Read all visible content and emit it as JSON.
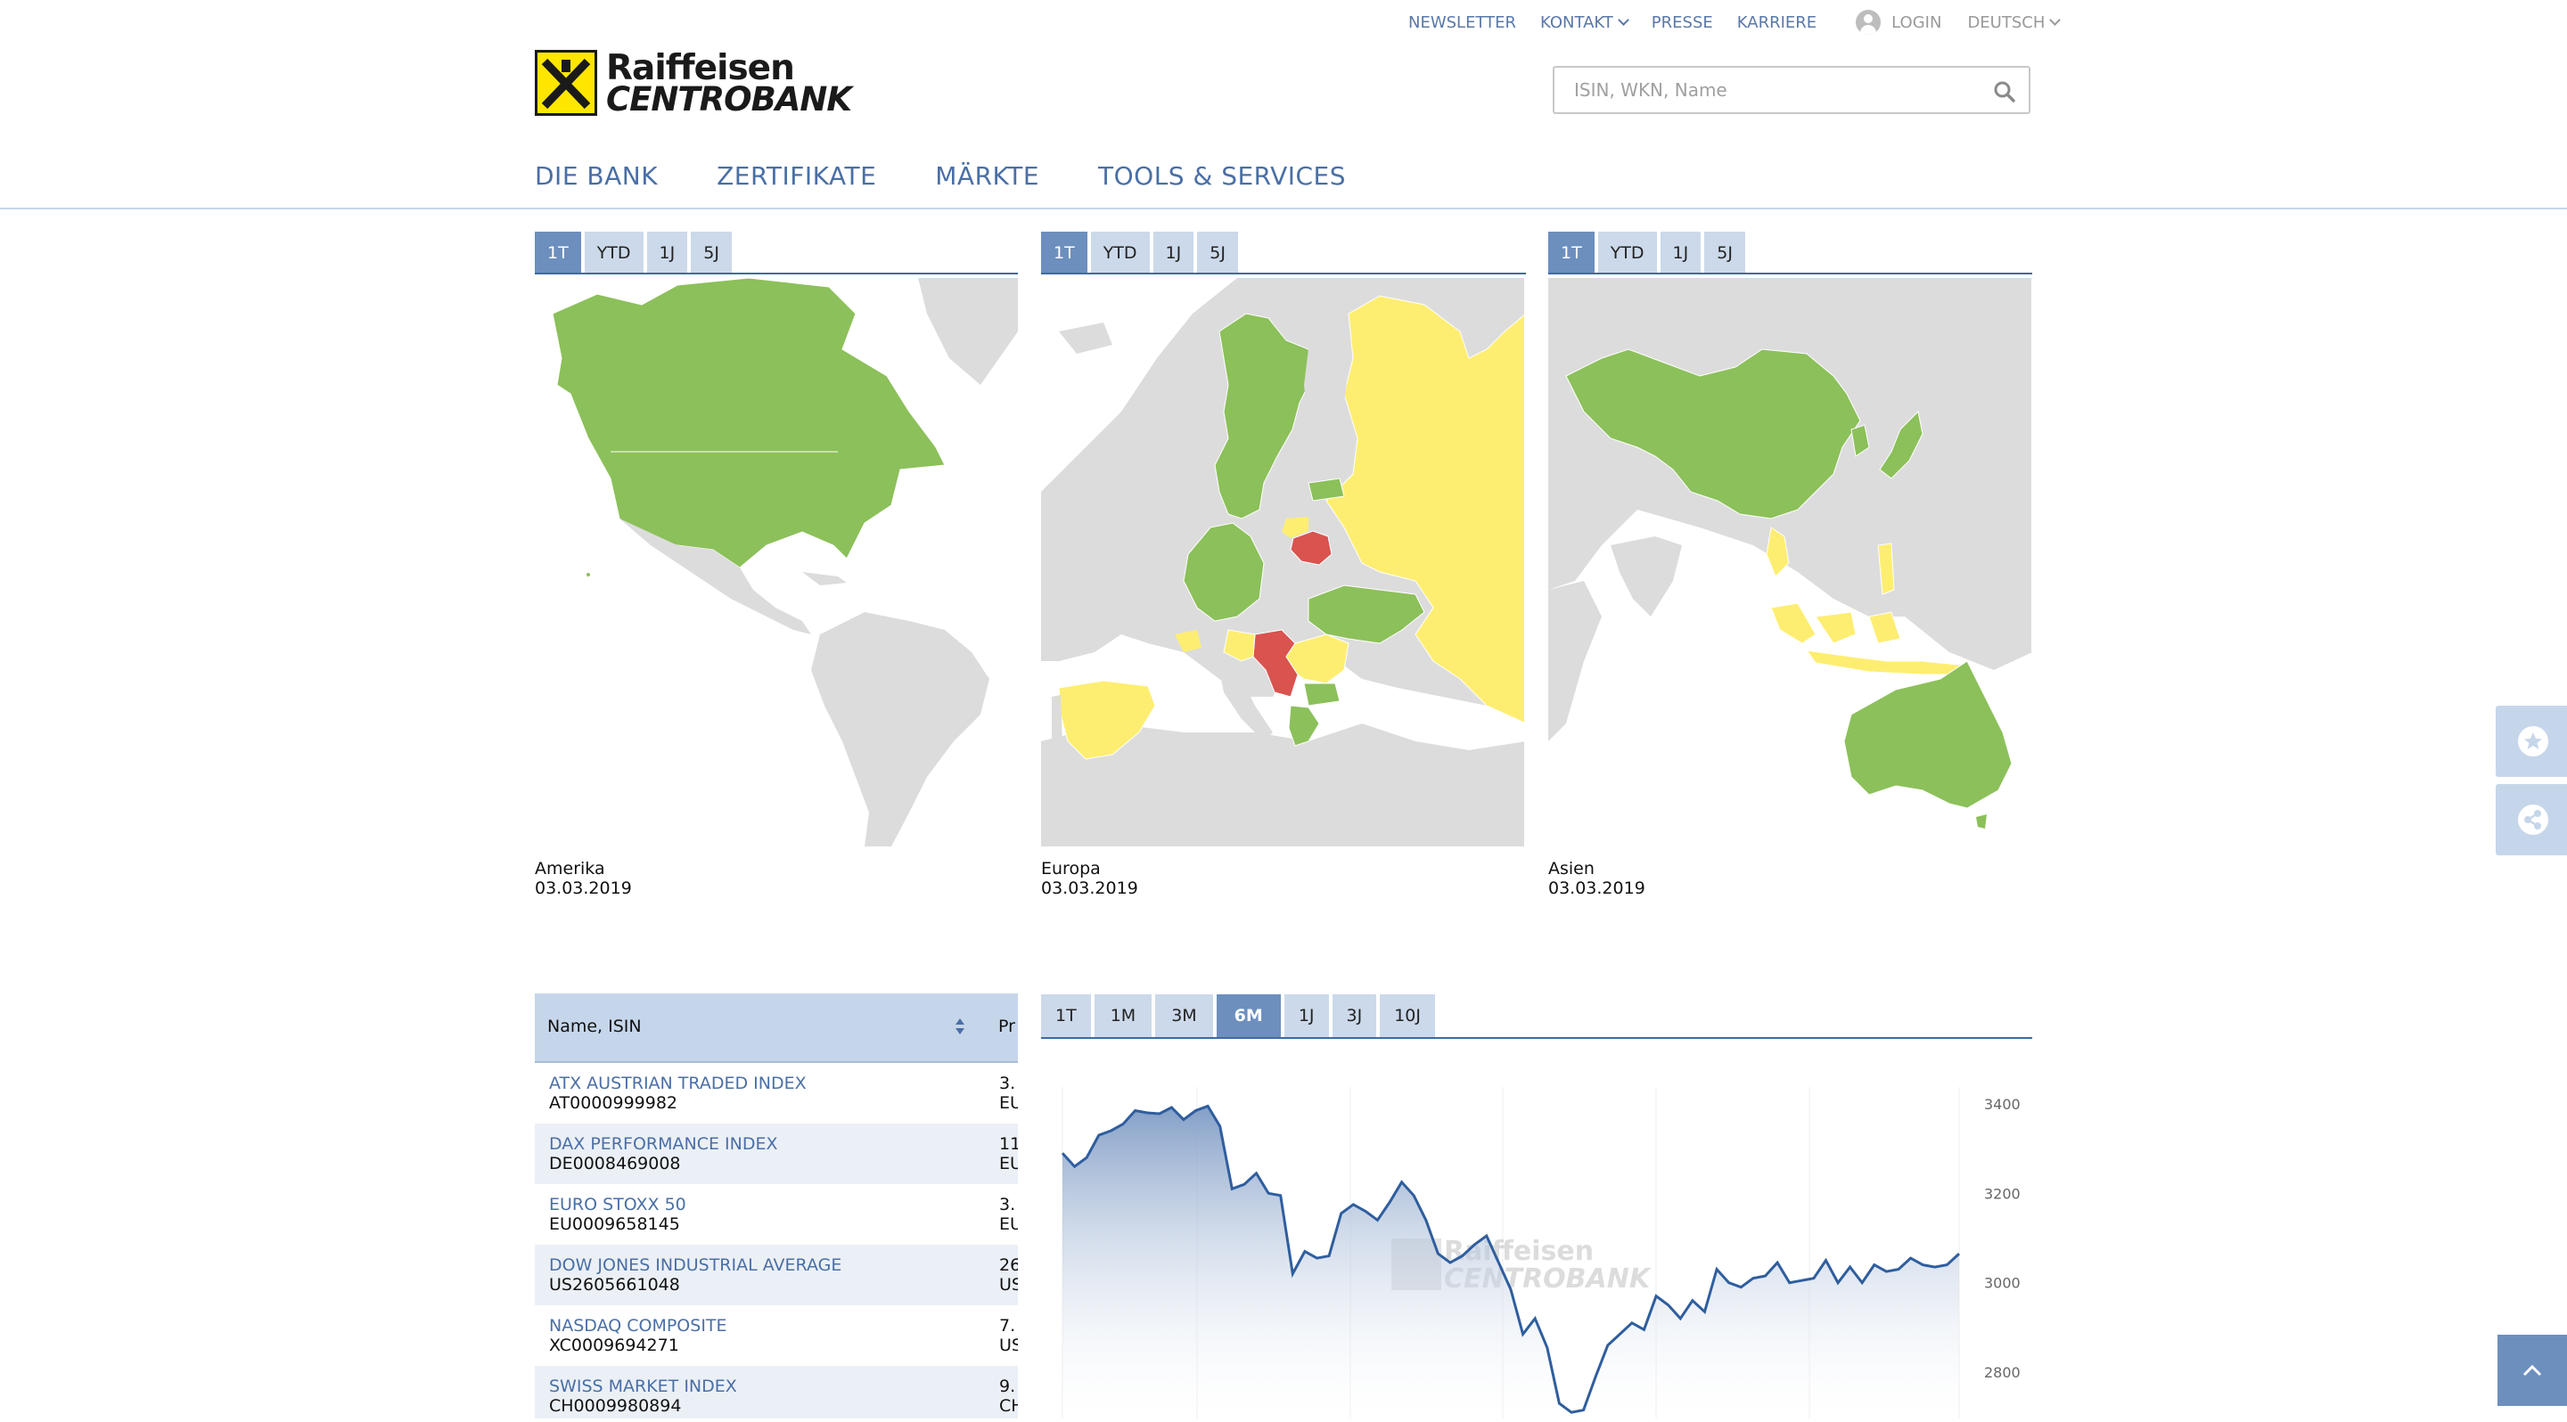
{
  "top_nav": {
    "newsletter": "NEWSLETTER",
    "kontakt": "KONTAKT",
    "presse": "PRESSE",
    "karriere": "KARRIERE",
    "login": "LOGIN",
    "language": "DEUTSCH"
  },
  "logo": {
    "line1": "Raiffeisen",
    "line2": "CENTROBANK"
  },
  "search": {
    "placeholder": "ISIN, WKN, Name",
    "icon": "search-icon"
  },
  "main_nav": [
    "DIE BANK",
    "ZERTIFIKATE",
    "MÄRKTE",
    "TOOLS & SERVICES"
  ],
  "map_tabs": [
    "1T",
    "YTD",
    "1J",
    "5J"
  ],
  "map_active_tab": "1T",
  "maps": [
    {
      "region": "Amerika",
      "date": "03.03.2019"
    },
    {
      "region": "Europa",
      "date": "03.03.2019"
    },
    {
      "region": "Asien",
      "date": "03.03.2019"
    }
  ],
  "colors": {
    "positive": "#8cc05a",
    "neutral": "#fdee72",
    "negative": "#d9534f",
    "land": "#dcdcdc",
    "accent": "#4a6fa5",
    "tab_active": "#6d8fbe",
    "tab_inactive": "#ccd9ea"
  },
  "table": {
    "columns": [
      "Name, ISIN",
      "Pr"
    ],
    "rows": [
      {
        "name": "ATX AUSTRIAN TRADED INDEX",
        "isin": "AT0000999982",
        "price_fragment": "3.",
        "currency_fragment": "EU"
      },
      {
        "name": "DAX PERFORMANCE INDEX",
        "isin": "DE0008469008",
        "price_fragment": "11",
        "currency_fragment": "EU"
      },
      {
        "name": "EURO STOXX 50",
        "isin": "EU0009658145",
        "price_fragment": "3.",
        "currency_fragment": "EU"
      },
      {
        "name": "DOW JONES INDUSTRIAL AVERAGE",
        "isin": "US2605661048",
        "price_fragment": "26",
        "currency_fragment": "US"
      },
      {
        "name": "NASDAQ COMPOSITE",
        "isin": "XC0009694271",
        "price_fragment": "7.",
        "currency_fragment": "US"
      },
      {
        "name": "SWISS MARKET INDEX",
        "isin": "CH0009980894",
        "price_fragment": "9.",
        "currency_fragment": "CH"
      }
    ]
  },
  "chart_tabs": [
    "1T",
    "1M",
    "3M",
    "6M",
    "1J",
    "3J",
    "10J"
  ],
  "chart_active_tab": "6M",
  "chart_data": {
    "type": "area",
    "title": "",
    "xlabel": "",
    "ylabel": "",
    "y_ticks": [
      3400,
      3200,
      3000,
      2800
    ],
    "ylim": [
      2700,
      3440
    ],
    "values": [
      3290,
      3260,
      3280,
      3330,
      3340,
      3355,
      3385,
      3380,
      3378,
      3392,
      3365,
      3385,
      3395,
      3350,
      3210,
      3220,
      3245,
      3200,
      3195,
      3020,
      3070,
      3055,
      3060,
      3155,
      3175,
      3160,
      3140,
      3180,
      3225,
      3195,
      3140,
      3065,
      3045,
      3060,
      3085,
      3105,
      3045,
      2985,
      2885,
      2920,
      2855,
      2730,
      2710,
      2715,
      2790,
      2860,
      2885,
      2910,
      2895,
      2970,
      2950,
      2920,
      2960,
      2935,
      3030,
      3000,
      2990,
      3010,
      3015,
      3045,
      3000,
      3005,
      3010,
      3050,
      3000,
      3035,
      3000,
      3040,
      3025,
      3030,
      3055,
      3040,
      3035,
      3040,
      3065
    ],
    "watermark": {
      "line1": "Raiffeisen",
      "line2": "CENTROBANK"
    }
  },
  "side_buttons": [
    "star-icon",
    "share-icon"
  ],
  "scroll_top_icon": "chevron-up-icon"
}
